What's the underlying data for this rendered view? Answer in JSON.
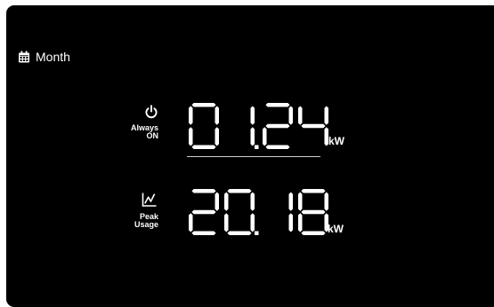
{
  "period": {
    "icon": "calendar-icon",
    "label": "Month"
  },
  "metrics": [
    {
      "icon": "power-icon",
      "label_line1": "Always",
      "label_line2": "ON",
      "value": "01.24",
      "unit": "kW"
    },
    {
      "icon": "line-chart-icon",
      "label_line1": "Peak",
      "label_line2": "Usage",
      "value": "20.18",
      "unit": "kW"
    }
  ],
  "colors": {
    "background": "#000000",
    "foreground": "#ffffff",
    "divider": "#cfcfcf"
  }
}
